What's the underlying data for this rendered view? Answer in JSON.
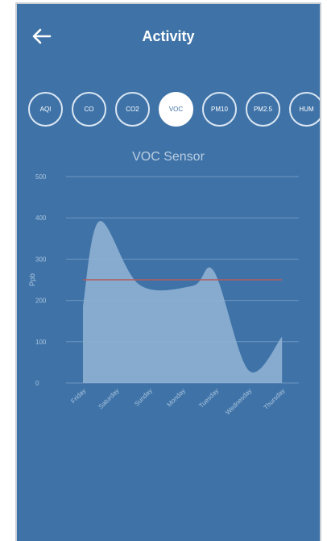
{
  "header": {
    "title": "Activity",
    "back_icon": "arrow-left-icon"
  },
  "tabs": [
    {
      "label": "AQI",
      "active": false
    },
    {
      "label": "CO",
      "active": false
    },
    {
      "label": "CO2",
      "active": false
    },
    {
      "label": "VOC",
      "active": true
    },
    {
      "label": "PM10",
      "active": false
    },
    {
      "label": "PM2.5",
      "active": false
    },
    {
      "label": "HUM",
      "active": false
    }
  ],
  "colors": {
    "background": "#3f73a8",
    "area_fill": "#8fb1d2",
    "threshold_line": "#b35b5b",
    "grid": "#6d95bf",
    "tick_text": "#a9c2dc"
  },
  "chart_data": {
    "type": "area",
    "title": "VOC Sensor",
    "ylabel": "Ppb",
    "xlabel": "",
    "categories": [
      "Friday",
      "Saturday",
      "Sunday",
      "Monday",
      "Tuesday",
      "Wednesday",
      "Thursday"
    ],
    "yticks": [
      "0",
      "100",
      "200",
      "300",
      "400",
      "500"
    ],
    "ylim": [
      0,
      500
    ],
    "x": [
      0,
      0.5,
      1.7,
      3.3,
      3.95,
      5.0,
      6.0
    ],
    "values": [
      185,
      392,
      238,
      235,
      270,
      30,
      112
    ],
    "threshold": 250,
    "grid": true
  }
}
